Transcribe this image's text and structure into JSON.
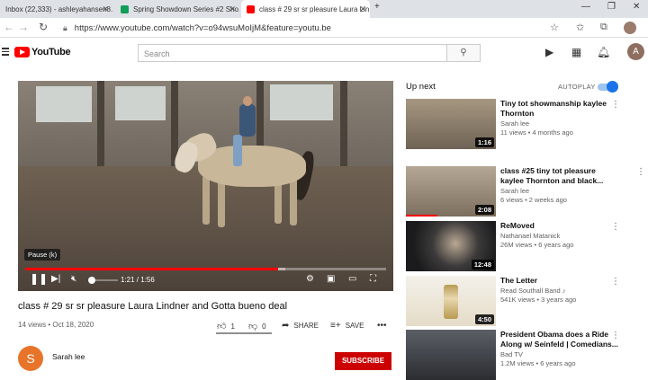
{
  "browser": {
    "tabs": [
      {
        "title": "Inbox (22,333) - ashleyahansen8...",
        "favicon_color": "#c5221f"
      },
      {
        "title": "Spring Showdown Series #2 Sho...",
        "favicon_color": "#0f9d58"
      },
      {
        "title": "class # 29 sr sr pleasure Laura Lin...",
        "favicon_color": "#ff0000"
      }
    ],
    "new_tab": "+",
    "url": "https://www.youtube.com/watch?v=o94wsuMoIjM&feature=youtu.be"
  },
  "header": {
    "logo_text": "YouTube",
    "search_placeholder": "Search",
    "avatar_letter": "A"
  },
  "player": {
    "tooltip": "Pause (k)",
    "time_current": "1:21",
    "time_total": "1:56",
    "progress": 0.7
  },
  "video": {
    "title": "class # 29 sr sr pleasure Laura Lindner and Gotta bueno deal",
    "meta": "14 views • Oct 18, 2020",
    "likes": "1",
    "dislikes": "0",
    "share_label": "SHARE",
    "save_label": "SAVE",
    "channel_name": "Sarah lee",
    "channel_initial": "S",
    "subscribe_label": "SUBSCRIBE"
  },
  "sidebar": {
    "up_next_label": "Up next",
    "autoplay_label": "AUTOPLAY",
    "autoplay_on": true,
    "items": [
      {
        "title": "Tiny tot showmanship kaylee Thornton",
        "channel": "Sarah lee",
        "stats": "11 views • 4 months ago",
        "duration": "1:16"
      },
      {
        "title": "class #25 tiny tot pleasure kaylee Thornton and black...",
        "channel": "Sarah lee",
        "stats": "6 views • 2 weeks ago",
        "duration": "2:08",
        "progress": 0.35
      },
      {
        "title": "ReMoved",
        "channel": "Nathanael Matanick",
        "stats": "26M views • 6 years ago",
        "duration": "12:48"
      },
      {
        "title": "The Letter",
        "channel": "Read Southall Band ♪",
        "stats": "541K views • 3 years ago",
        "duration": "4:50"
      },
      {
        "title": "President Obama does a Ride Along w/ Seinfeld | Comedians...",
        "channel": "Bad TV",
        "stats": "1.2M views • 6 years ago",
        "duration": ""
      }
    ]
  }
}
